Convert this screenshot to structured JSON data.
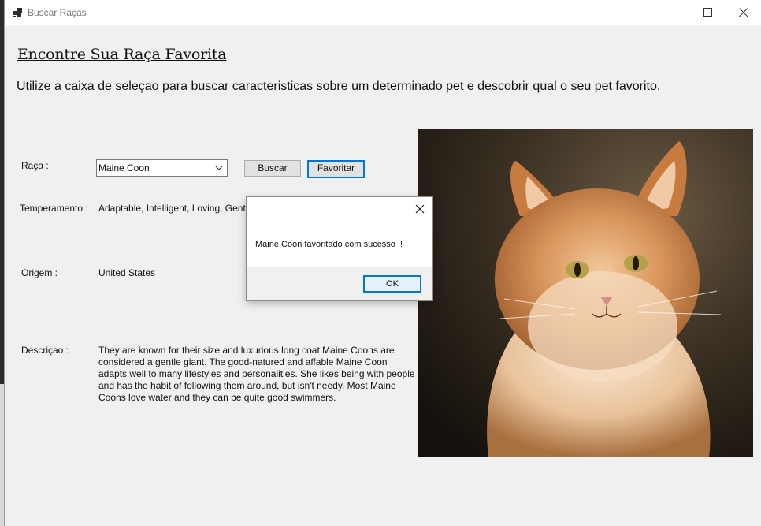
{
  "window": {
    "title": "Buscar Raças"
  },
  "page": {
    "heading": "Encontre Sua Raça Favorita",
    "intro": "Utilize a caixa de seleçao para buscar caracteristicas sobre um determinado pet e descobrir qual o seu pet favorito."
  },
  "form": {
    "raca_label": "Raça :",
    "raca_selected": "Maine Coon",
    "buscar_label": "Buscar",
    "favoritar_label": "Favoritar",
    "temperamento_label": "Temperamento :",
    "temperamento_value": "Adaptable, Intelligent, Loving, Gentle",
    "origem_label": "Origem :",
    "origem_value": "United States",
    "descricao_label": "Descriçao :",
    "descricao_value": "They are known for their size and luxurious long coat Maine Coons are considered a gentle giant. The good-natured and affable Maine Coon adapts well to many lifestyles and personalities. She likes being with people and has the habit of following them around, but isn't needy. Most Maine Coons love water and they can be quite good swimmers."
  },
  "dialog": {
    "message": "Maine Coon favoritado com sucesso !!",
    "ok_label": "OK"
  },
  "colors": {
    "accent": "#0078d7",
    "window_bg": "#f0f0f0"
  },
  "icons": {
    "app": "app-grid-icon",
    "minimize": "minimize-icon",
    "maximize": "maximize-icon",
    "close": "close-icon",
    "dropdown": "chevron-down-icon"
  }
}
